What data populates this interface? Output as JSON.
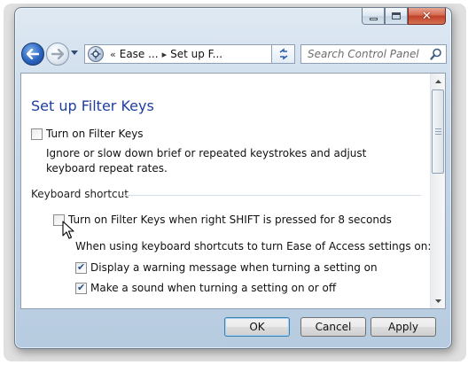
{
  "window": {
    "caption_buttons": [
      "minimize",
      "maximize",
      "close"
    ]
  },
  "nav": {
    "address": {
      "prefix": "«",
      "crumbs": [
        "Ease ...",
        "Set up F..."
      ]
    },
    "search": {
      "placeholder": "Search Control Panel"
    }
  },
  "main": {
    "title": "Set up Filter Keys",
    "filter_keys": {
      "label": "Turn on Filter Keys",
      "checked": false
    },
    "description": "Ignore or slow down brief or repeated keystrokes and adjust keyboard repeat rates.",
    "shortcut_group": {
      "heading": "Keyboard shortcut",
      "shift_option": {
        "label": "Turn on Filter Keys when right SHIFT is pressed for 8 seconds",
        "checked": false
      },
      "sub_heading": "When using keyboard shortcuts to turn Ease of Access settings on:",
      "warning_option": {
        "label": "Display a warning message when turning a setting on",
        "checked": true
      },
      "sound_option": {
        "label": "Make a sound when turning a setting on or off",
        "checked": true
      }
    }
  },
  "footer": {
    "ok": "OK",
    "cancel": "Cancel",
    "apply": "Apply"
  },
  "colors": {
    "title_blue": "#1e3fa0",
    "window_frame": "#c5d6e7",
    "close_red": "#c1402a"
  },
  "icons": [
    "back-arrow-icon",
    "forward-arrow-icon",
    "control-panel-icon",
    "refresh-icon",
    "search-icon",
    "mouse-cursor-icon"
  ]
}
